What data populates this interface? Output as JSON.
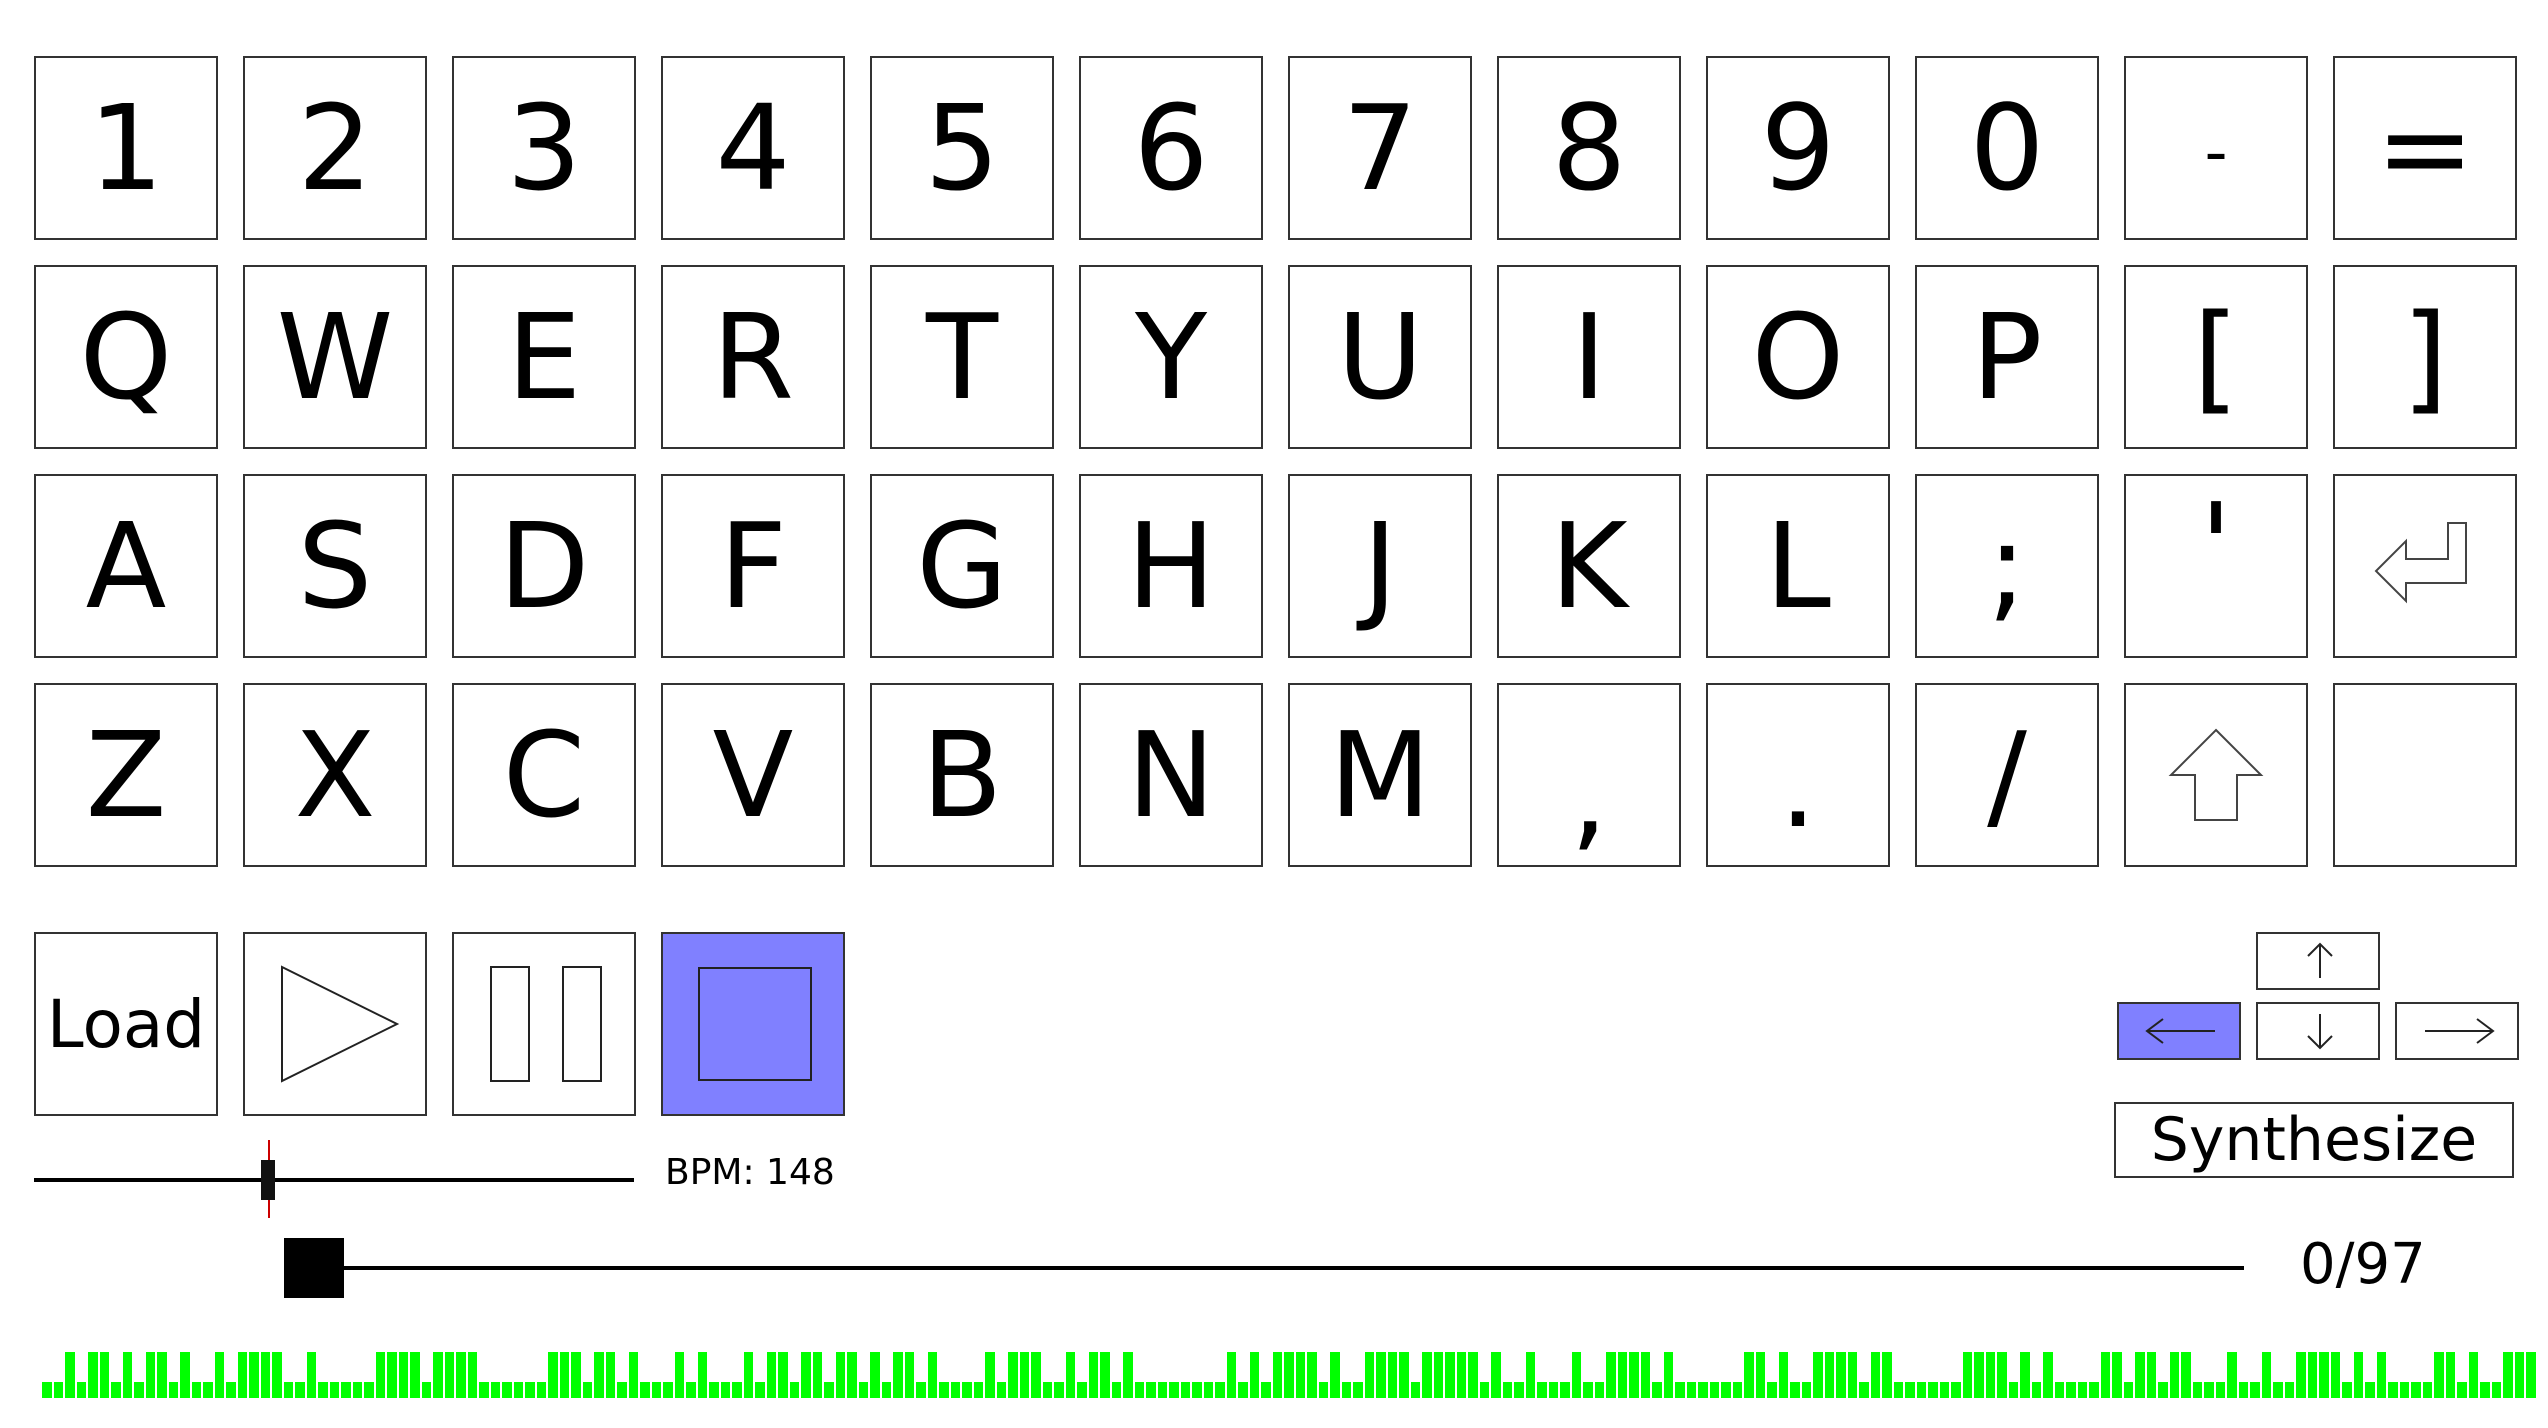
{
  "keyboard": {
    "rows": [
      [
        "1",
        "2",
        "3",
        "4",
        "5",
        "6",
        "7",
        "8",
        "9",
        "0",
        "-",
        "="
      ],
      [
        "Q",
        "W",
        "E",
        "R",
        "T",
        "Y",
        "U",
        "I",
        "O",
        "P",
        "[",
        "]"
      ],
      [
        "A",
        "S",
        "D",
        "F",
        "G",
        "H",
        "J",
        "K",
        "L",
        ";",
        "'",
        "enter-icon"
      ],
      [
        "Z",
        "X",
        "C",
        "V",
        "B",
        "N",
        "M",
        ",",
        ".",
        "/",
        "shift-icon",
        ""
      ]
    ]
  },
  "controls": {
    "load_label": "Load",
    "play_icon": "play-icon",
    "pause_icon": "pause-icon",
    "stop_icon": "stop-icon",
    "active": "stop"
  },
  "direction_pad": {
    "up": "arrow-up-icon",
    "down": "arrow-down-icon",
    "left": "arrow-left-icon",
    "right": "arrow-right-icon",
    "active": "left"
  },
  "synthesize_label": "Synthesize",
  "tempo": {
    "label": "BPM: 148",
    "value": 148,
    "slider_fraction": 0.39
  },
  "playback": {
    "text": "0/97",
    "position": 0,
    "total": 97
  },
  "sequence": {
    "pattern": "0010110101101001011110010000011110111100000011101101000101000101101101101011010000101110010110100000000101011110100111101111101001000100111101000000110100111101100000011110101000011011011000100100111101010000110100111",
    "color": "#00ff00"
  },
  "colors": {
    "active_button": "#8080ff",
    "sequence": "#00ff00",
    "slider_marker": "#cc0000"
  }
}
